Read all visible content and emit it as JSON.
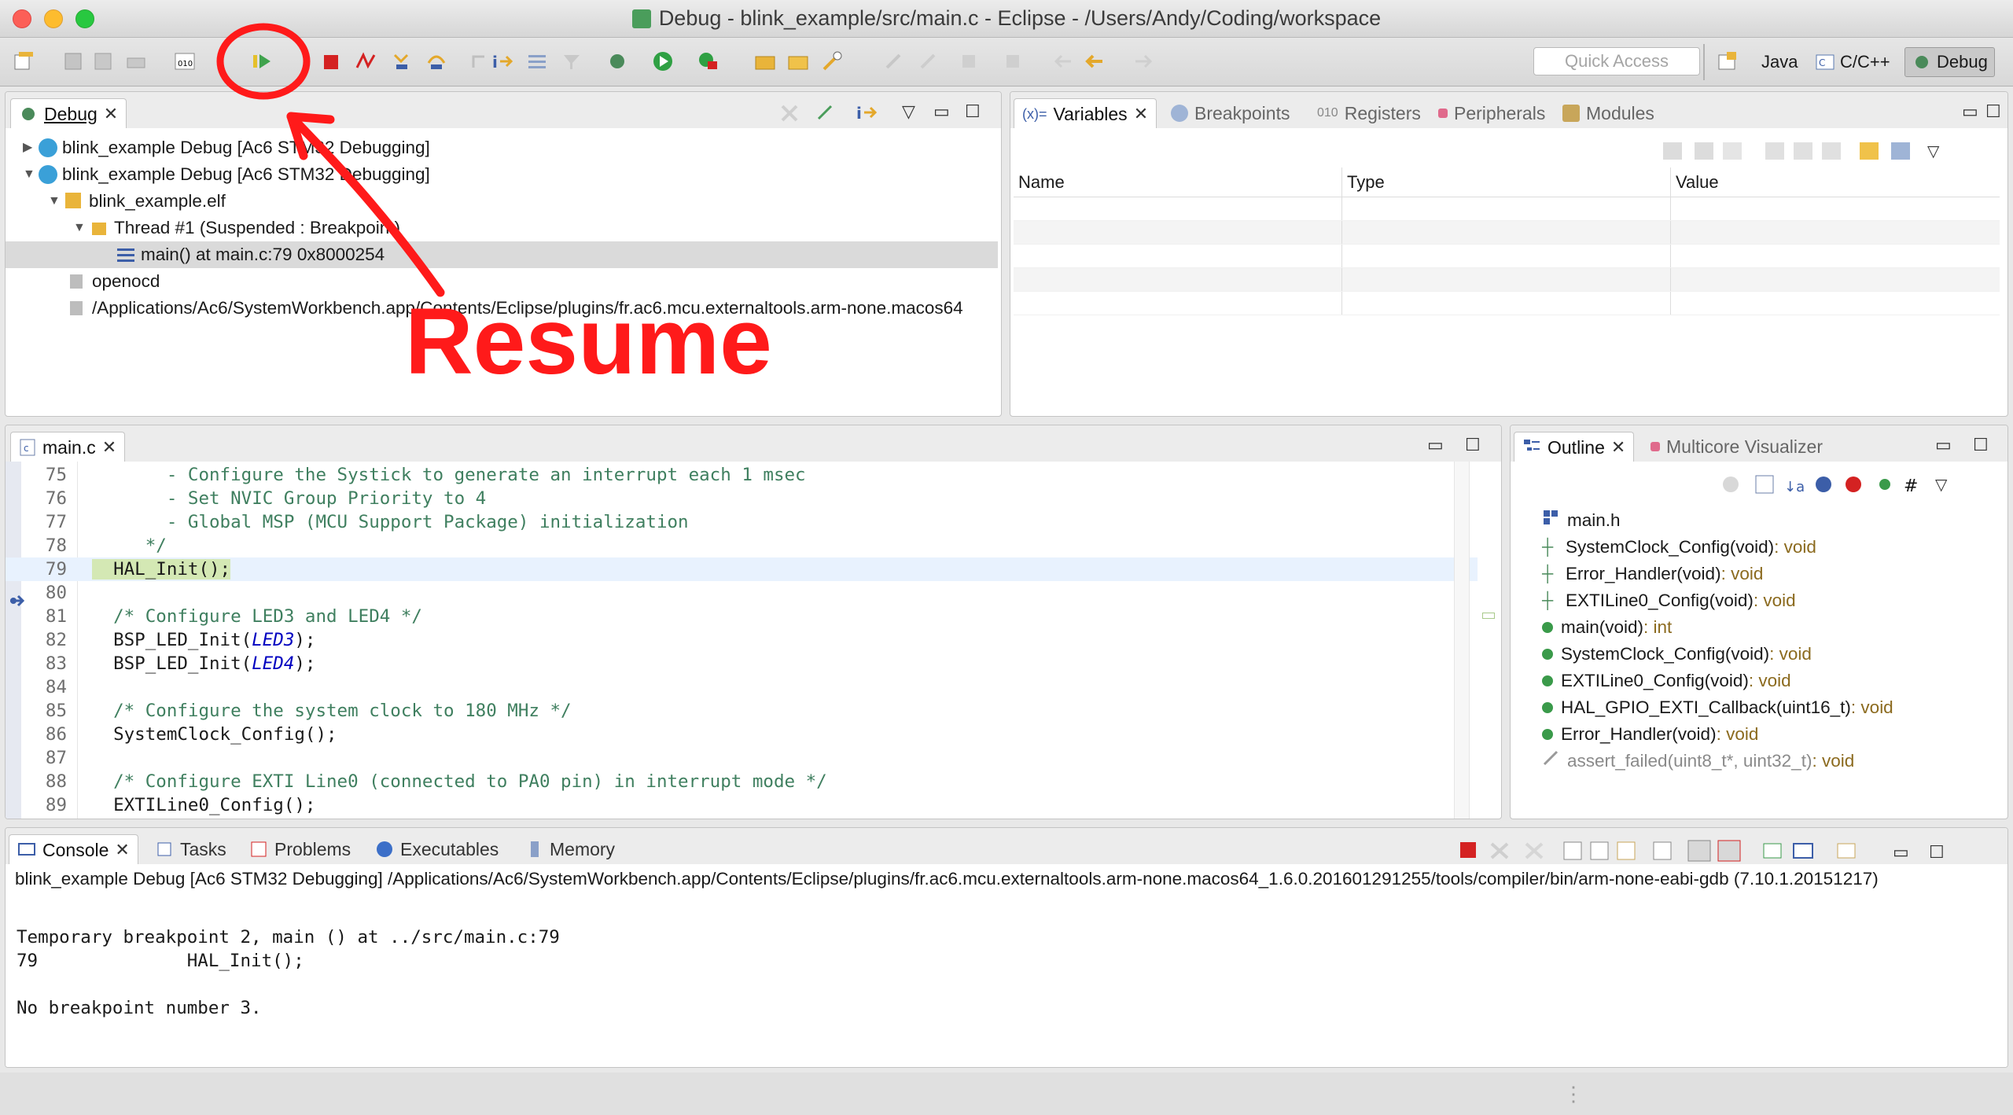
{
  "window": {
    "title": "Debug - blink_example/src/main.c - Eclipse - /Users/Andy/Coding/workspace"
  },
  "toolbar": {
    "quick_access_placeholder": "Quick Access",
    "perspectives": [
      {
        "label": "Java"
      },
      {
        "label": "C/C++"
      },
      {
        "label": "Debug"
      }
    ]
  },
  "debug_view": {
    "tab_label": "Debug",
    "rows": [
      {
        "label": "blink_example Debug [Ac6 STM32 Debugging]",
        "expanded": false
      },
      {
        "label": "blink_example Debug [Ac6 STM32 Debugging]",
        "expanded": true
      },
      {
        "label": "blink_example.elf",
        "expanded": true
      },
      {
        "label": "Thread #1 (Suspended : Breakpoint)",
        "expanded": true
      },
      {
        "label": "main() at main.c:79 0x8000254"
      },
      {
        "label": "openocd"
      },
      {
        "label": "/Applications/Ac6/SystemWorkbench.app/Contents/Eclipse/plugins/fr.ac6.mcu.externaltools.arm-none.macos64"
      }
    ]
  },
  "variables_view": {
    "tabs": [
      "Variables",
      "Breakpoints",
      "Registers",
      "Peripherals",
      "Modules"
    ],
    "columns": [
      "Name",
      "Type",
      "Value"
    ]
  },
  "editor": {
    "tab_label": "main.c",
    "lines": [
      {
        "num": "75",
        "text": "       - Configure the Systick to generate an interrupt each 1 msec",
        "kind": "comment"
      },
      {
        "num": "76",
        "text": "       - Set NVIC Group Priority to 4",
        "kind": "comment"
      },
      {
        "num": "77",
        "text": "       - Global MSP (MCU Support Package) initialization",
        "kind": "comment"
      },
      {
        "num": "78",
        "text": "     */",
        "kind": "comment"
      },
      {
        "num": "79",
        "text": "  HAL_Init();",
        "kind": "current"
      },
      {
        "num": "80",
        "text": "",
        "kind": "code"
      },
      {
        "num": "81",
        "text": "  /* Configure LED3 and LED4 */",
        "kind": "comment"
      },
      {
        "num": "82",
        "text": "  BSP_LED_Init(",
        "kind": "code",
        "arg": "LED3",
        "tail": ");"
      },
      {
        "num": "83",
        "text": "  BSP_LED_Init(",
        "kind": "code",
        "arg": "LED4",
        "tail": ");"
      },
      {
        "num": "84",
        "text": "",
        "kind": "code"
      },
      {
        "num": "85",
        "text": "  /* Configure the system clock to 180 MHz */",
        "kind": "comment"
      },
      {
        "num": "86",
        "text": "  SystemClock_Config();",
        "kind": "code"
      },
      {
        "num": "87",
        "text": "",
        "kind": "code"
      },
      {
        "num": "88",
        "text": "  /* Configure EXTI Line0 (connected to PA0 pin) in interrupt mode */",
        "kind": "comment"
      },
      {
        "num": "89",
        "text": "  EXTILine0_Config();",
        "kind": "code"
      }
    ]
  },
  "outline_view": {
    "tabs": [
      "Outline",
      "Multicore Visualizer"
    ],
    "items": [
      {
        "name": "main.h",
        "type": "",
        "icon": "header"
      },
      {
        "name": "SystemClock_Config(void)",
        "type": " : void",
        "icon": "decl-static"
      },
      {
        "name": "Error_Handler(void)",
        "type": " : void",
        "icon": "decl-static"
      },
      {
        "name": "EXTILine0_Config(void)",
        "type": " : void",
        "icon": "decl-static"
      },
      {
        "name": "main(void)",
        "type": " : int",
        "icon": "func"
      },
      {
        "name": "SystemClock_Config(void)",
        "type": " : void",
        "icon": "func-static"
      },
      {
        "name": "EXTILine0_Config(void)",
        "type": " : void",
        "icon": "func-static"
      },
      {
        "name": "HAL_GPIO_EXTI_Callback(uint16_t)",
        "type": " : void",
        "icon": "func"
      },
      {
        "name": "Error_Handler(void)",
        "type": " : void",
        "icon": "func-static"
      },
      {
        "name": "assert_failed(uint8_t*, uint32_t)",
        "type": " : void",
        "icon": "func-grey"
      }
    ]
  },
  "console_view": {
    "tabs": [
      "Console",
      "Tasks",
      "Problems",
      "Executables",
      "Memory"
    ],
    "header": "blink_example Debug [Ac6 STM32 Debugging] /Applications/Ac6/SystemWorkbench.app/Contents/Eclipse/plugins/fr.ac6.mcu.externaltools.arm-none.macos64_1.6.0.201601291255/tools/compiler/bin/arm-none-eabi-gdb (7.10.1.20151217)",
    "lines": [
      "Temporary breakpoint 2, main () at ../src/main.c:79",
      "79\t\tHAL_Init();",
      "",
      "No breakpoint number 3."
    ]
  },
  "annotation": {
    "label": "Resume",
    "color": "#ff1a1a"
  }
}
